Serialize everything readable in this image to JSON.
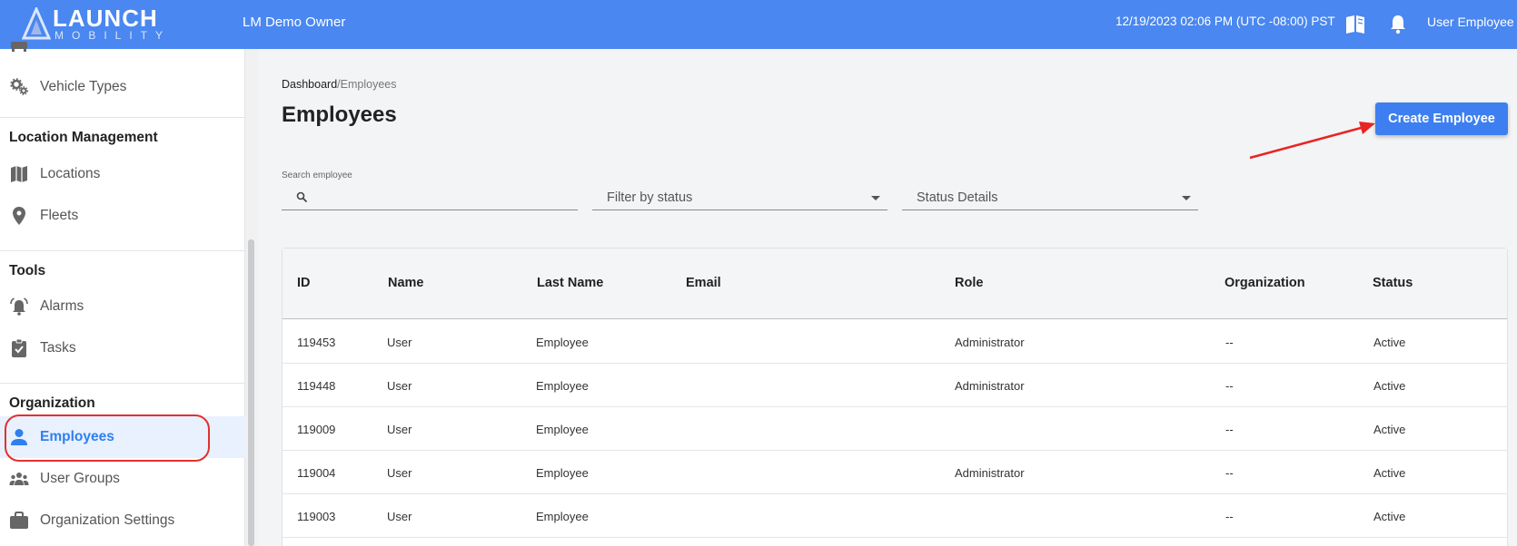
{
  "header": {
    "logo_text": "LAUNCH",
    "logo_sub": "MOBILITY",
    "org_name": "LM Demo Owner",
    "datetime": "12/19/2023 02:06 PM (UTC -08:00) PST",
    "user_name": "User Employee",
    "brand_color": "#4a87f0"
  },
  "sidebar": {
    "items_top": [
      {
        "label": "Vehicle Types",
        "icon": "gears-icon"
      }
    ],
    "sections": [
      {
        "title": "Location Management",
        "items": [
          {
            "label": "Locations",
            "icon": "map-icon"
          },
          {
            "label": "Fleets",
            "icon": "map-pin-icon"
          }
        ]
      },
      {
        "title": "Tools",
        "items": [
          {
            "label": "Alarms",
            "icon": "alarm-bell-icon"
          },
          {
            "label": "Tasks",
            "icon": "clipboard-check-icon"
          }
        ]
      },
      {
        "title": "Organization",
        "items": [
          {
            "label": "Employees",
            "icon": "person-icon",
            "active": true
          },
          {
            "label": "User Groups",
            "icon": "users-icon"
          },
          {
            "label": "Organization Settings",
            "icon": "briefcase-icon"
          }
        ]
      }
    ]
  },
  "main": {
    "breadcrumb": {
      "home": "Dashboard",
      "separator": "/",
      "current": "Employees"
    },
    "title": "Employees",
    "create_button": "Create Employee",
    "search": {
      "label": "Search employee",
      "value": "",
      "placeholder": ""
    },
    "filter_status": "Filter by status",
    "status_details": "Status Details"
  },
  "table": {
    "columns": [
      "ID",
      "Name",
      "Last Name",
      "Email",
      "Role",
      "Organization",
      "Status"
    ],
    "rows": [
      [
        "119453",
        "User",
        "Employee",
        "",
        "Administrator",
        "--",
        "Active"
      ],
      [
        "119448",
        "User",
        "Employee",
        "",
        "Administrator",
        "--",
        "Active"
      ],
      [
        "119009",
        "User",
        "Employee",
        "",
        "",
        "--",
        "Active"
      ],
      [
        "119004",
        "User",
        "Employee",
        "",
        "Administrator",
        "--",
        "Active"
      ],
      [
        "119003",
        "User",
        "Employee",
        "",
        "",
        "--",
        "Active"
      ]
    ]
  }
}
